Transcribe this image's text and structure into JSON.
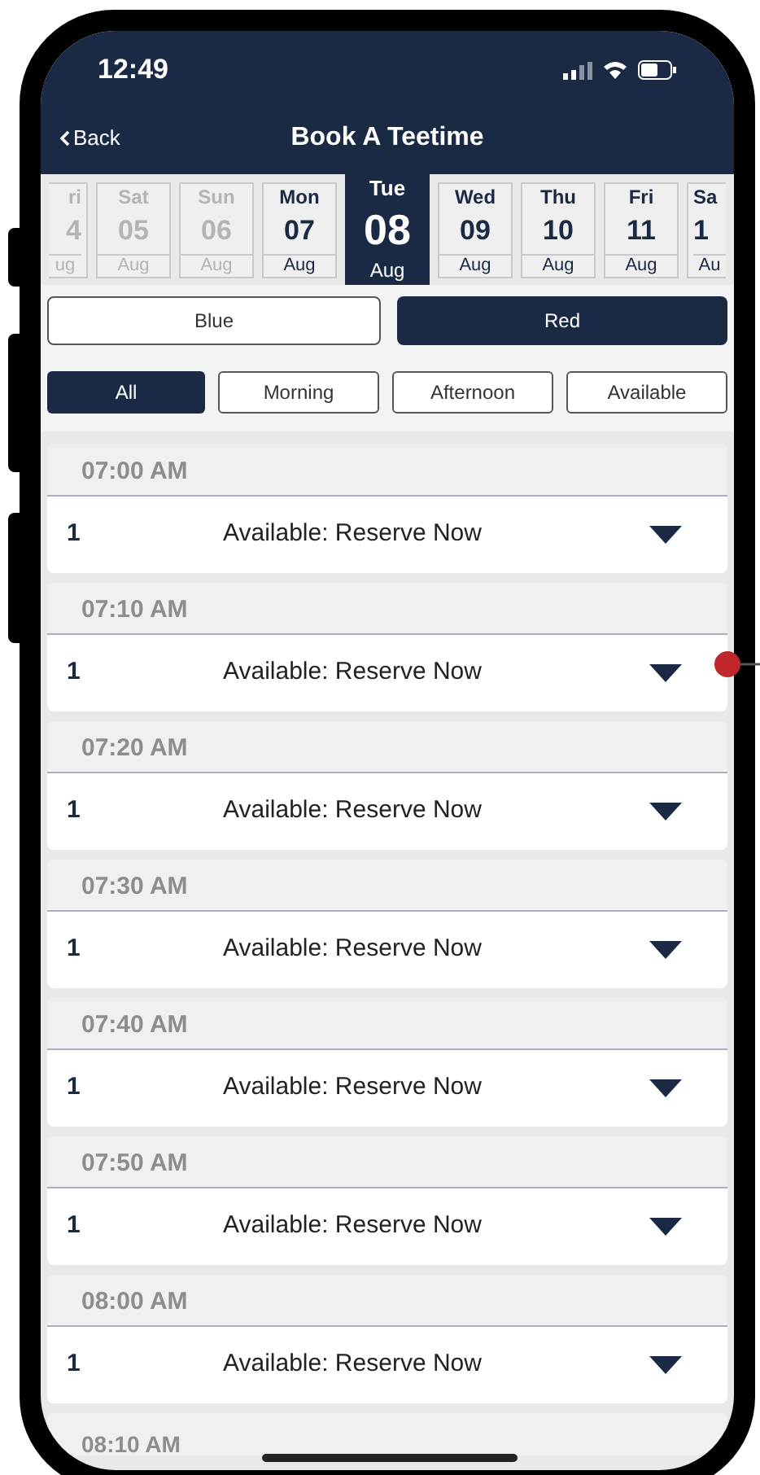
{
  "status_bar": {
    "time": "12:49"
  },
  "nav": {
    "back": "Back",
    "title": "Book A Teetime"
  },
  "dates": [
    {
      "weekday": "ri",
      "day": "4",
      "month": "ug",
      "disabled": true,
      "selected": false
    },
    {
      "weekday": "Sat",
      "day": "05",
      "month": "Aug",
      "disabled": true,
      "selected": false
    },
    {
      "weekday": "Sun",
      "day": "06",
      "month": "Aug",
      "disabled": true,
      "selected": false
    },
    {
      "weekday": "Mon",
      "day": "07",
      "month": "Aug",
      "disabled": false,
      "selected": false
    },
    {
      "weekday": "Tue",
      "day": "08",
      "month": "Aug",
      "disabled": false,
      "selected": true
    },
    {
      "weekday": "Wed",
      "day": "09",
      "month": "Aug",
      "disabled": false,
      "selected": false
    },
    {
      "weekday": "Thu",
      "day": "10",
      "month": "Aug",
      "disabled": false,
      "selected": false
    },
    {
      "weekday": "Fri",
      "day": "11",
      "month": "Aug",
      "disabled": false,
      "selected": false
    },
    {
      "weekday": "Sa",
      "day": "1",
      "month": "Au",
      "disabled": false,
      "selected": false
    }
  ],
  "courses": [
    {
      "label": "Blue",
      "selected": false
    },
    {
      "label": "Red",
      "selected": true
    }
  ],
  "filters": [
    {
      "label": "All",
      "selected": true
    },
    {
      "label": "Morning",
      "selected": false
    },
    {
      "label": "Afternoon",
      "selected": false
    },
    {
      "label": "Available",
      "selected": false
    }
  ],
  "slots": [
    {
      "time": "07:00 AM",
      "players": "1",
      "status": "Available: Reserve Now"
    },
    {
      "time": "07:10 AM",
      "players": "1",
      "status": "Available: Reserve Now"
    },
    {
      "time": "07:20 AM",
      "players": "1",
      "status": "Available: Reserve Now"
    },
    {
      "time": "07:30 AM",
      "players": "1",
      "status": "Available: Reserve Now"
    },
    {
      "time": "07:40 AM",
      "players": "1",
      "status": "Available: Reserve Now"
    },
    {
      "time": "07:50 AM",
      "players": "1",
      "status": "Available: Reserve Now"
    },
    {
      "time": "08:00 AM",
      "players": "1",
      "status": "Available: Reserve Now"
    }
  ],
  "next_slot": {
    "time": "08:10 AM"
  },
  "annotation": {
    "color": "#c0272d"
  }
}
